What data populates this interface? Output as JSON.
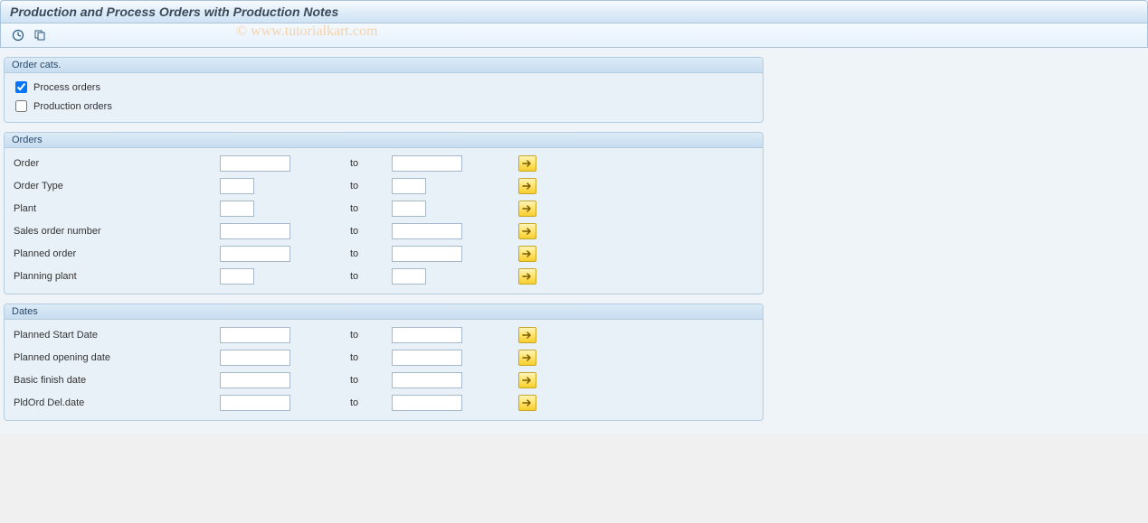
{
  "title": "Production and Process Orders with Production Notes",
  "watermark": "© www.tutorialkart.com",
  "toolbar": {
    "execute_icon": "execute",
    "variant_icon": "variant"
  },
  "groups": {
    "order_cats": {
      "title": "Order cats.",
      "process_orders": {
        "label": "Process orders",
        "checked": true
      },
      "production_orders": {
        "label": "Production orders",
        "checked": false
      }
    },
    "orders": {
      "title": "Orders",
      "rows": [
        {
          "label": "Order",
          "size": "lg"
        },
        {
          "label": "Order Type",
          "size": "sm"
        },
        {
          "label": "Plant",
          "size": "sm"
        },
        {
          "label": "Sales order number",
          "size": "lg"
        },
        {
          "label": "Planned order",
          "size": "lg"
        },
        {
          "label": "Planning plant",
          "size": "sm"
        }
      ]
    },
    "dates": {
      "title": "Dates",
      "rows": [
        {
          "label": "Planned Start Date",
          "size": "lg"
        },
        {
          "label": "Planned opening date",
          "size": "lg"
        },
        {
          "label": "Basic finish date",
          "size": "lg"
        },
        {
          "label": "PldOrd Del.date",
          "size": "lg"
        }
      ]
    }
  },
  "common": {
    "to": "to"
  }
}
